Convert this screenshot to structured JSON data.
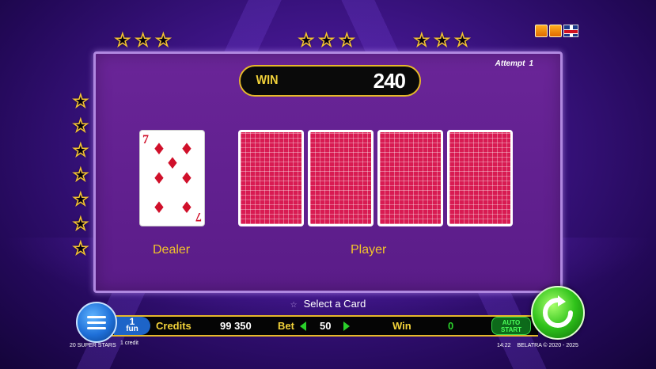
{
  "header": {
    "attempt_label": "Attempt",
    "attempt_value": "1",
    "win_label": "WIN",
    "win_value": "240"
  },
  "cards": {
    "dealer": {
      "rank": "7",
      "suit": "diamonds",
      "suit_symbol": "♦"
    },
    "player_count": 4
  },
  "labels": {
    "dealer": "Dealer",
    "player": "Player",
    "instruction": "Select a Card"
  },
  "bottom_bar": {
    "fun_value": "1",
    "fun_label": "fun",
    "credit_small": "1 credit",
    "credits_label": "Credits",
    "credits_value": "99 350",
    "bet_label": "Bet",
    "bet_value": "50",
    "win_label": "Win",
    "win_value": "0",
    "auto_label": "AUTO",
    "start_label": "START"
  },
  "footer": {
    "game_name": "20 SUPER STARS",
    "time": "14:22",
    "copyright": "BELATRA © 2020 - 2025"
  },
  "colors": {
    "accent_gold": "#f2c42a",
    "card_back": "#d81b52",
    "panel": "#5a1c88",
    "start_green": "#2fc21a"
  },
  "icons": [
    "star-icon",
    "sound-icon",
    "settings-icon",
    "uk-flag-icon",
    "menu-icon",
    "refresh-icon"
  ]
}
